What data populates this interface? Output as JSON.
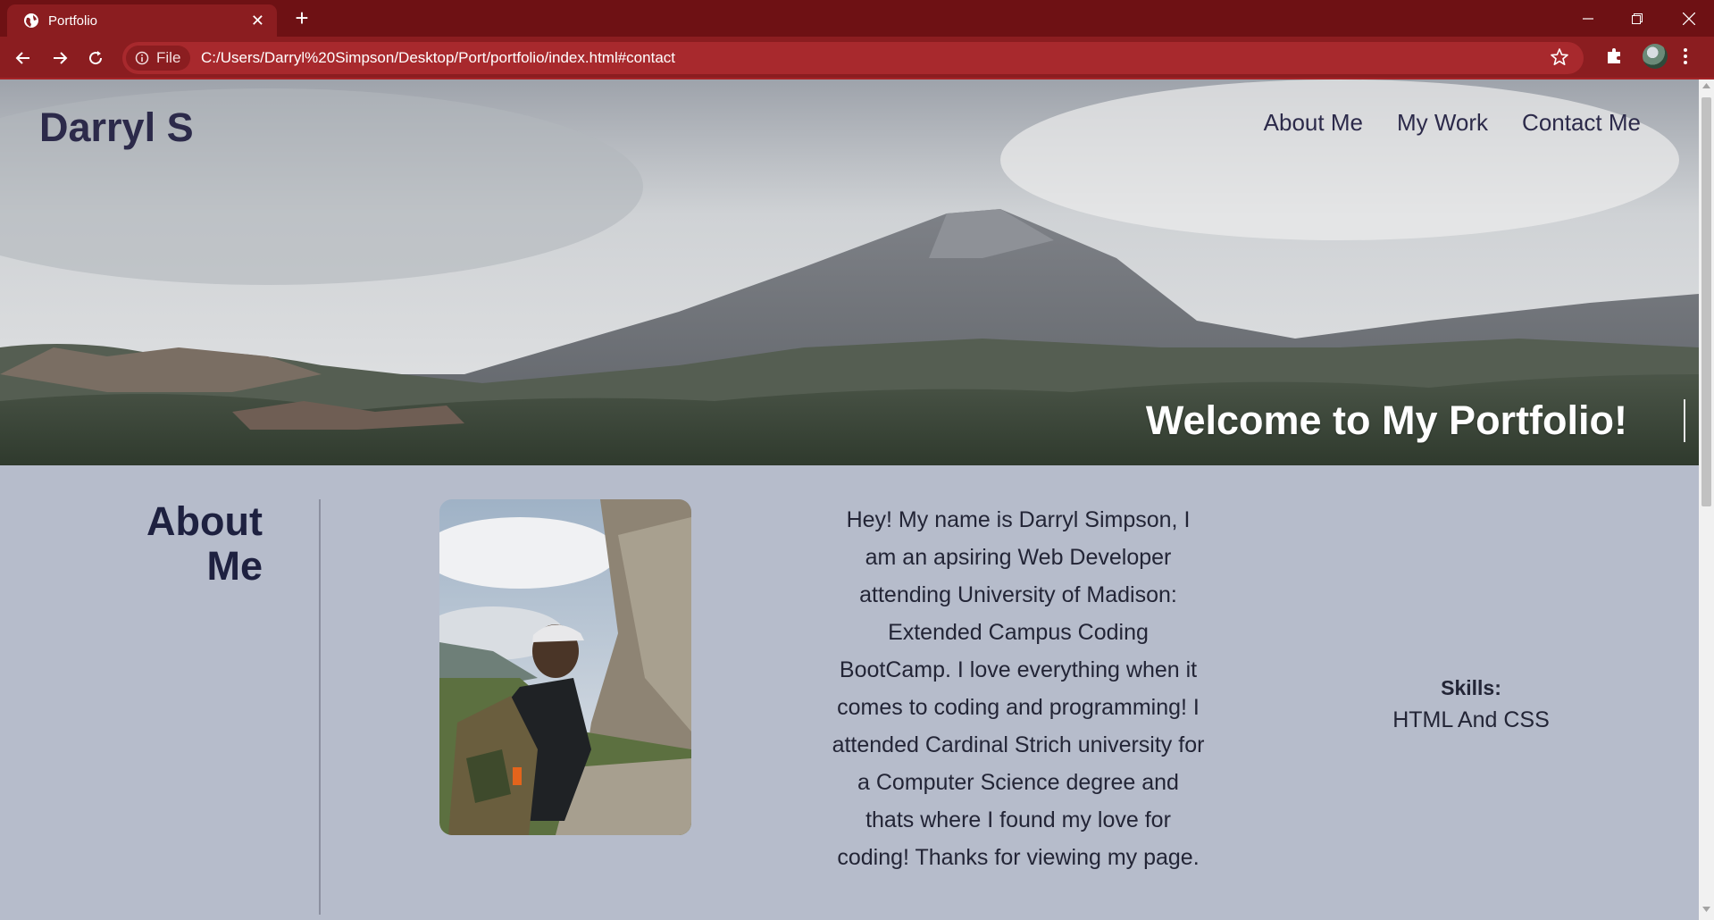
{
  "browser": {
    "tab_title": "Portfolio",
    "tab_close_glyph": "✕",
    "new_tab_glyph": "+",
    "security_label": "File",
    "url": "C:/Users/Darryl%20Simpson/Desktop/Port/portfolio/index.html#contact",
    "icons": [
      "globe-icon",
      "close-icon",
      "plus-icon",
      "minimize-icon",
      "restore-icon",
      "window-close-icon",
      "back-arrow-icon",
      "forward-arrow-icon",
      "reload-icon",
      "info-icon",
      "star-icon",
      "puzzle-icon",
      "avatar",
      "kebab-menu-icon"
    ],
    "colors": {
      "frame": "#6e1114",
      "toolbar": "#8b1d20",
      "omnibox": "#a8292d"
    }
  },
  "site": {
    "brand": "Darryl S",
    "nav": [
      {
        "label": "About Me"
      },
      {
        "label": "My Work"
      },
      {
        "label": "Contact Me"
      }
    ],
    "welcome": "Welcome to My Portfolio!"
  },
  "about": {
    "title_line1": "About",
    "title_line2": "Me",
    "bio": "Hey! My name is Darryl Simpson, I am an apsiring Web Developer attending University of Madison: Extended Campus Coding BootCamp. I love everything when it comes to coding and programming! I attended Cardinal Strich university for a Computer Science degree and thats where I found my love for coding! Thanks for viewing my page.",
    "skills_title": "Skills:",
    "skills_value": "HTML And CSS"
  },
  "colors": {
    "heading": "#2c2a4a",
    "section_bg": "#b6bccb",
    "welcome": "#ffffff"
  }
}
